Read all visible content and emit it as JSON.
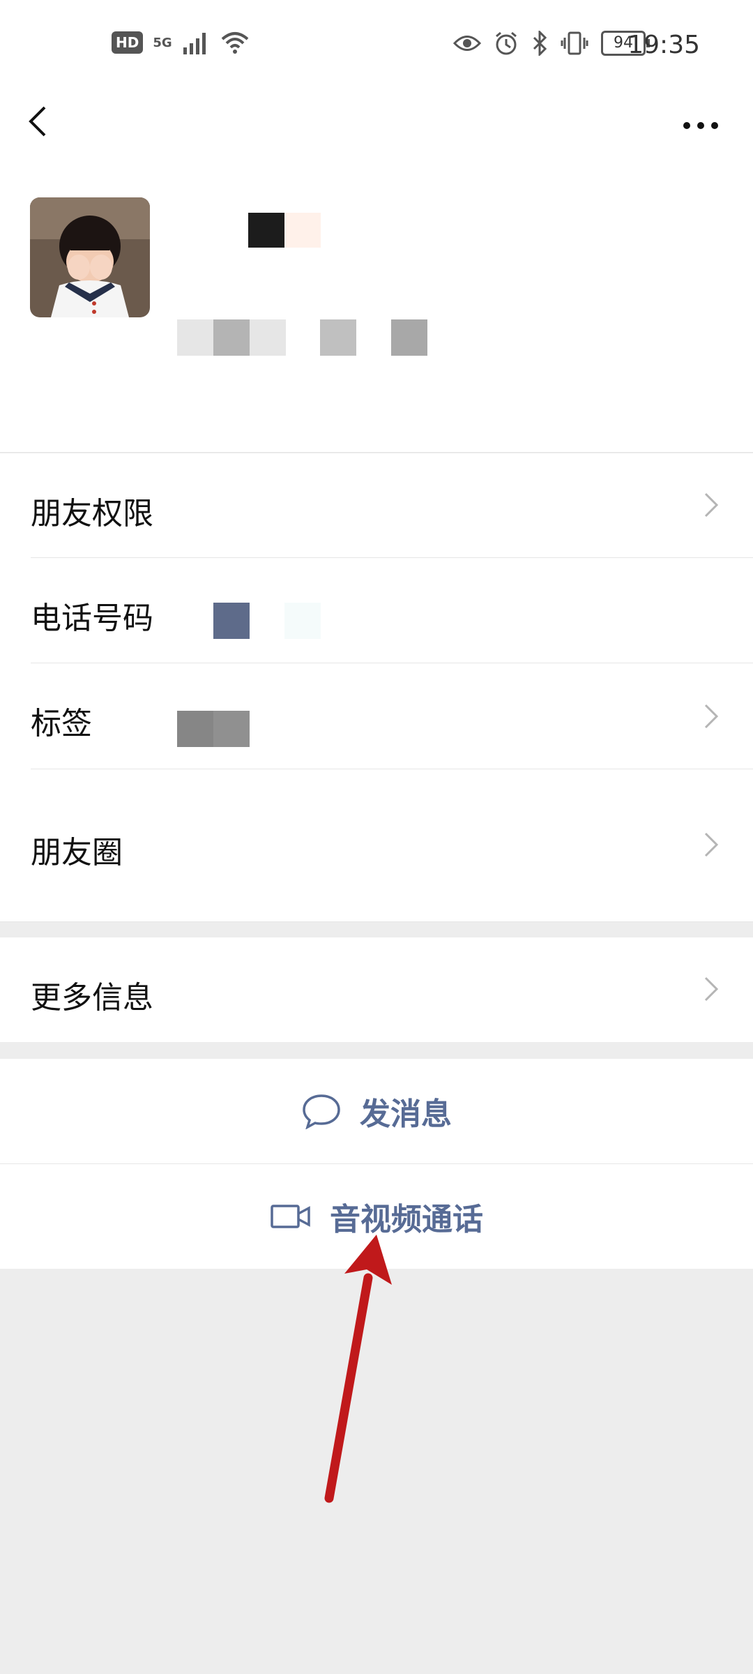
{
  "status_bar": {
    "network": "5G",
    "hd": "HD",
    "battery": "94",
    "time": "19:35"
  },
  "menu": {
    "friend_permission": "朋友权限",
    "phone_number": "电话号码",
    "tags": "标签",
    "moments": "朋友圈",
    "more_info": "更多信息"
  },
  "actions": {
    "send_message": "发消息",
    "video_call": "音视频通话"
  },
  "colors": {
    "link": "#576b95",
    "background": "#ededed",
    "annotation_arrow": "#c0191b"
  }
}
